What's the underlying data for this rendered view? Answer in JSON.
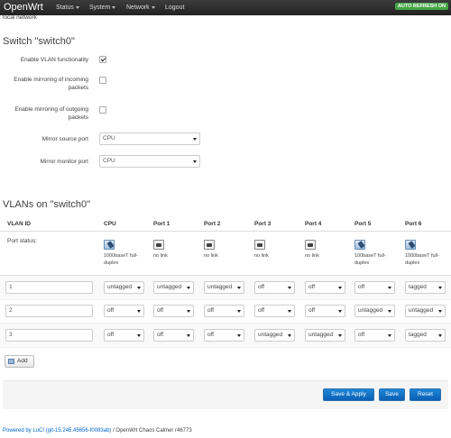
{
  "header": {
    "brand": "OpenWrt",
    "menu": [
      {
        "label": "Status",
        "dropdown": true
      },
      {
        "label": "System",
        "dropdown": true
      },
      {
        "label": "Network",
        "dropdown": true
      },
      {
        "label": "Logout",
        "dropdown": false
      }
    ],
    "auto_refresh": "AUTO REFRESH ON",
    "auto_refresh_color": "#46a546"
  },
  "breadcrumb": "local network",
  "switch_section": {
    "title": "Switch \"switch0\"",
    "enable_vlan": {
      "label": "Enable VLAN functionality",
      "checked": true
    },
    "mirror_incoming": {
      "label": "Enable mirroring of incoming packets",
      "checked": false
    },
    "mirror_outgoing": {
      "label": "Enable mirroring of outgoing packets",
      "checked": false
    },
    "mirror_source": {
      "label": "Mirror source port",
      "value": "CPU"
    },
    "mirror_monitor": {
      "label": "Mirror monitor port",
      "value": "CPU"
    }
  },
  "vlans_section": {
    "title": "VLANs on \"switch0\"",
    "columns": [
      "VLAN ID",
      "CPU",
      "Port 1",
      "Port 2",
      "Port 3",
      "Port 4",
      "Port 5",
      "Port 6"
    ],
    "port_status_label": "Port status:",
    "port_status": [
      {
        "icon": "port-linked-icon",
        "text": "1000baseT full-duplex"
      },
      {
        "icon": "port-nolink-icon",
        "text": "no link"
      },
      {
        "icon": "port-nolink-icon",
        "text": "no link"
      },
      {
        "icon": "port-nolink-icon",
        "text": "no link"
      },
      {
        "icon": "port-nolink-icon",
        "text": "no link"
      },
      {
        "icon": "port-linked-icon",
        "text": "100baseT full-duplex"
      },
      {
        "icon": "port-linked-icon",
        "text": "1000baseT full-duplex"
      }
    ],
    "rows": [
      {
        "id": "1",
        "cells": [
          "untagged",
          "untagged",
          "untagged",
          "off",
          "off",
          "off",
          "tagged"
        ]
      },
      {
        "id": "2",
        "cells": [
          "off",
          "off",
          "off",
          "off",
          "off",
          "untagged",
          "untagged"
        ]
      },
      {
        "id": "3",
        "cells": [
          "off",
          "off",
          "off",
          "untagged",
          "untagged",
          "off",
          "tagged"
        ]
      }
    ],
    "add_label": "Add"
  },
  "actions": {
    "save_apply": "Save & Apply",
    "save": "Save",
    "reset": "Reset",
    "button_color": "#0960b5"
  },
  "footer": {
    "link": "Powered by LuCI (git-15.245.45656-f0083ab)",
    "suffix": " / OpenWrt Chaos Calmer r46773"
  }
}
